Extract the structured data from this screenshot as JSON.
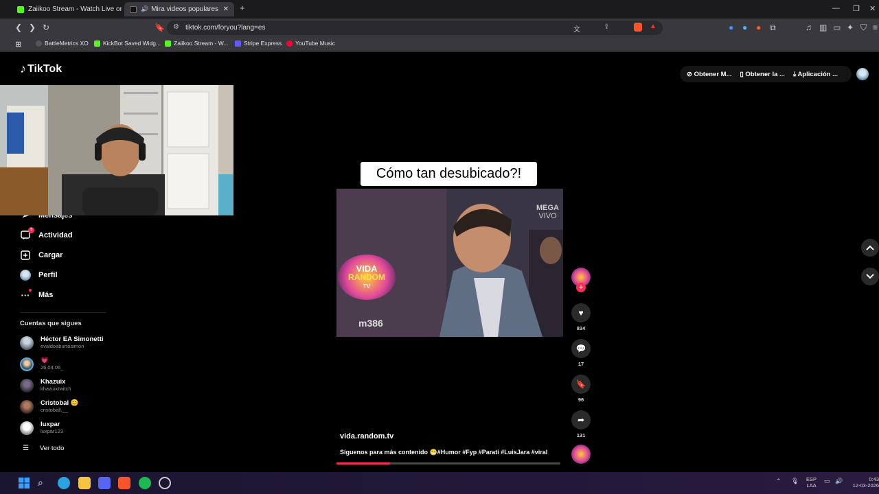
{
  "browser": {
    "tabs": [
      {
        "title": "Zaiikoo Stream - Watch Live on Kick",
        "active": false
      },
      {
        "title": "Mira videos populares selecc",
        "active": true
      }
    ],
    "new_tab": "+",
    "window_controls": [
      "—",
      "❐",
      "✕"
    ],
    "url": "tiktok.com/foryou?lang=es",
    "bookmarks": [
      "BattleMetrics XO",
      "KickBot Saved Widg...",
      "Zaiikoo Stream - W...",
      "Stripe Express",
      "YouTube Music"
    ]
  },
  "tiktok": {
    "logo": "TikTok",
    "top_actions": [
      "Obtener M...",
      "Obtener la ...",
      "Aplicación ..."
    ],
    "nav": [
      {
        "label": "Mensajes",
        "icon": "paper-plane-icon"
      },
      {
        "label": "Actividad",
        "icon": "activity-icon",
        "badge": "7"
      },
      {
        "label": "Cargar",
        "icon": "upload-icon"
      },
      {
        "label": "Perfil",
        "icon": "profile-icon"
      },
      {
        "label": "Más",
        "icon": "more-icon"
      }
    ],
    "following_title": "Cuentas que sigues",
    "following": [
      {
        "name": "Héctor EA Simonetti",
        "handle": "evaldoaburtosimon"
      },
      {
        "name": "💗",
        "handle": "26.04.06_"
      },
      {
        "name": "Khazuix",
        "handle": "khazuixtwitch"
      },
      {
        "name": "Cristobal 😊",
        "handle": "cristoball.__"
      },
      {
        "name": "luxpar",
        "handle": "luxpar123"
      }
    ],
    "see_all": "Ver todo",
    "video": {
      "caption": "Cómo tan desubicado?!",
      "channel_tag": "MEGA",
      "live_tag": "VIVO",
      "logo_text_1": "VIDA",
      "logo_text_2": "RANDOM",
      "logo_text_3": "TV",
      "watermark": "m386",
      "author": "vida.random.tv",
      "description": "Síguenos para más contenido 😁#Humor #Fyp #Parati #LuisJara #viral",
      "progress": 0.24
    },
    "actions": {
      "likes": "834",
      "comments": "17",
      "saves": "96",
      "shares": "131"
    }
  },
  "taskbar": {
    "lang": "ESP",
    "lang2": "LAA",
    "time": "0:43",
    "date": "12-03-2026"
  }
}
